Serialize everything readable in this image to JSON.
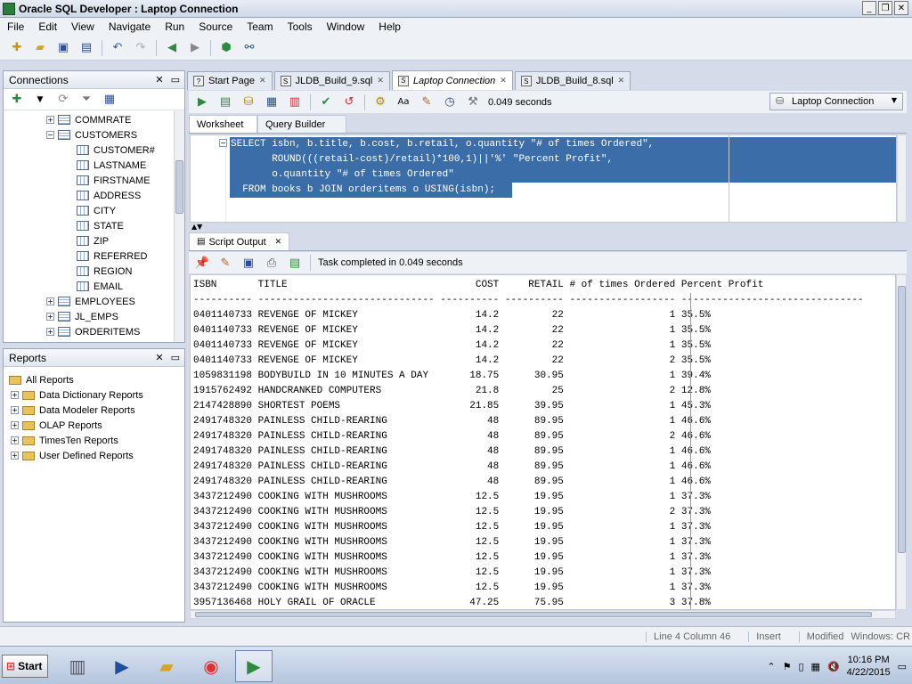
{
  "window": {
    "title": "Oracle SQL Developer : Laptop Connection"
  },
  "menu": [
    "File",
    "Edit",
    "View",
    "Navigate",
    "Run",
    "Source",
    "Team",
    "Tools",
    "Window",
    "Help"
  ],
  "connections": {
    "title": "Connections",
    "tree": [
      {
        "label": "COMMRATE",
        "type": "table",
        "expander": "+"
      },
      {
        "label": "CUSTOMERS",
        "type": "table",
        "expander": "−"
      },
      {
        "label": "CUSTOMER#",
        "type": "column"
      },
      {
        "label": "LASTNAME",
        "type": "column"
      },
      {
        "label": "FIRSTNAME",
        "type": "column"
      },
      {
        "label": "ADDRESS",
        "type": "column"
      },
      {
        "label": "CITY",
        "type": "column"
      },
      {
        "label": "STATE",
        "type": "column"
      },
      {
        "label": "ZIP",
        "type": "column"
      },
      {
        "label": "REFERRED",
        "type": "column"
      },
      {
        "label": "REGION",
        "type": "column"
      },
      {
        "label": "EMAIL",
        "type": "column"
      },
      {
        "label": "EMPLOYEES",
        "type": "table",
        "expander": "+"
      },
      {
        "label": "JL_EMPS",
        "type": "table",
        "expander": "+"
      },
      {
        "label": "ORDERITEMS",
        "type": "table",
        "expander": "+"
      },
      {
        "label": "ORDERS",
        "type": "table",
        "expander": "+"
      }
    ]
  },
  "reports": {
    "title": "Reports",
    "items": [
      {
        "label": "All Reports",
        "root": true
      },
      {
        "label": "Data Dictionary Reports"
      },
      {
        "label": "Data Modeler Reports"
      },
      {
        "label": "OLAP Reports"
      },
      {
        "label": "TimesTen Reports"
      },
      {
        "label": "User Defined Reports"
      }
    ]
  },
  "tabs": [
    {
      "label": "Start Page",
      "active": false
    },
    {
      "label": "JLDB_Build_9.sql",
      "active": false
    },
    {
      "label": "Laptop Connection",
      "active": true
    },
    {
      "label": "JLDB_Build_8.sql",
      "active": false
    }
  ],
  "editor_bar": {
    "timing": "0.049 seconds",
    "connection": "Laptop Connection"
  },
  "subtabs": [
    "Worksheet",
    "Query Builder"
  ],
  "sql": [
    "SELECT isbn, b.title, b.cost, b.retail, o.quantity \"# of times Ordered\",",
    "       ROUND(((retail-cost)/retail)*100,1)||'%' \"Percent Profit\",",
    "       o.quantity \"# of times Ordered\"",
    "  FROM books b JOIN orderitems o USING(isbn);"
  ],
  "script_output": {
    "tab_label": "Script Output",
    "status": "Task completed in 0.049 seconds",
    "header": "ISBN       TITLE                                COST     RETAIL # of times Ordered Percent Profit",
    "divider": "---------- ------------------------------ ---------- ---------- ------------------ -------------------------------",
    "rows": [
      "0401140733 REVENGE OF MICKEY                    14.2         22                  1 35.5%",
      "0401140733 REVENGE OF MICKEY                    14.2         22                  1 35.5%",
      "0401140733 REVENGE OF MICKEY                    14.2         22                  1 35.5%",
      "0401140733 REVENGE OF MICKEY                    14.2         22                  2 35.5%",
      "1059831198 BODYBUILD IN 10 MINUTES A DAY       18.75      30.95                  1 39.4%",
      "1915762492 HANDCRANKED COMPUTERS                21.8         25                  2 12.8%",
      "2147428890 SHORTEST POEMS                      21.85      39.95                  1 45.3%",
      "2491748320 PAINLESS CHILD-REARING                 48      89.95                  1 46.6%",
      "2491748320 PAINLESS CHILD-REARING                 48      89.95                  2 46.6%",
      "2491748320 PAINLESS CHILD-REARING                 48      89.95                  1 46.6%",
      "2491748320 PAINLESS CHILD-REARING                 48      89.95                  1 46.6%",
      "2491748320 PAINLESS CHILD-REARING                 48      89.95                  1 46.6%",
      "3437212490 COOKING WITH MUSHROOMS               12.5      19.95                  1 37.3%",
      "3437212490 COOKING WITH MUSHROOMS               12.5      19.95                  2 37.3%",
      "3437212490 COOKING WITH MUSHROOMS               12.5      19.95                  1 37.3%",
      "3437212490 COOKING WITH MUSHROOMS               12.5      19.95                  1 37.3%",
      "3437212490 COOKING WITH MUSHROOMS               12.5      19.95                  1 37.3%",
      "3437212490 COOKING WITH MUSHROOMS               12.5      19.95                  1 37.3%",
      "3437212490 COOKING WITH MUSHROOMS               12.5      19.95                  1 37.3%",
      "3957136468 HOLY GRAIL OF ORACLE                47.25      75.95                  3 37.8%"
    ]
  },
  "statusbar": {
    "position": "Line 4 Column 46",
    "mode": "Insert",
    "state": "Modified",
    "platform": "Windows: CR"
  },
  "taskbar": {
    "start": "Start",
    "time": "10:16 PM",
    "date": "4/22/2015"
  }
}
